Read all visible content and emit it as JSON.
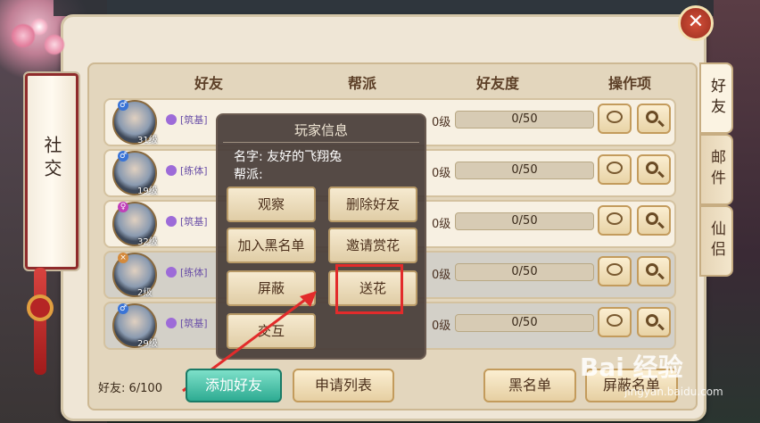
{
  "side_panel": {
    "title": "社交"
  },
  "columns": [
    "好友",
    "帮派",
    "好友度",
    "操作项"
  ],
  "side_tabs": [
    "好友",
    "邮件",
    "仙侣"
  ],
  "rows": [
    {
      "level": "31级",
      "tag": "[筑基]",
      "fav_level": "0级",
      "fav_progress": "0/50",
      "gender": "male",
      "dim": false
    },
    {
      "level": "19级",
      "tag": "[练体]",
      "fav_level": "0级",
      "fav_progress": "0/50",
      "gender": "male",
      "dim": false
    },
    {
      "level": "32级",
      "tag": "[筑基]",
      "fav_level": "0级",
      "fav_progress": "0/50",
      "gender": "female",
      "dim": false
    },
    {
      "level": "2级",
      "tag": "[练体]",
      "fav_level": "0级",
      "fav_progress": "0/50",
      "gender": "other",
      "dim": true
    },
    {
      "level": "29级",
      "tag": "[筑基]",
      "fav_level": "0级",
      "fav_progress": "0/50",
      "gender": "male",
      "dim": true
    }
  ],
  "popup": {
    "title": "玩家信息",
    "name_line": "名字: 友好的飞翔兔",
    "guild_line": "帮派:",
    "buttons": [
      "观察",
      "删除好友",
      "加入黑名单",
      "邀请赏花",
      "屏蔽",
      "送花",
      "交互"
    ]
  },
  "footer": {
    "friend_count": "好友:  6/100",
    "add_friend": "添加好友",
    "request_list": "申请列表",
    "blacklist": "黑名单",
    "block_list": "屏蔽名单"
  },
  "watermark": {
    "main": "Bai 经验",
    "sub": "jingyan.baidu.com"
  },
  "colors": {
    "highlight": "#e22b2b",
    "green_button": "#2eab92"
  }
}
